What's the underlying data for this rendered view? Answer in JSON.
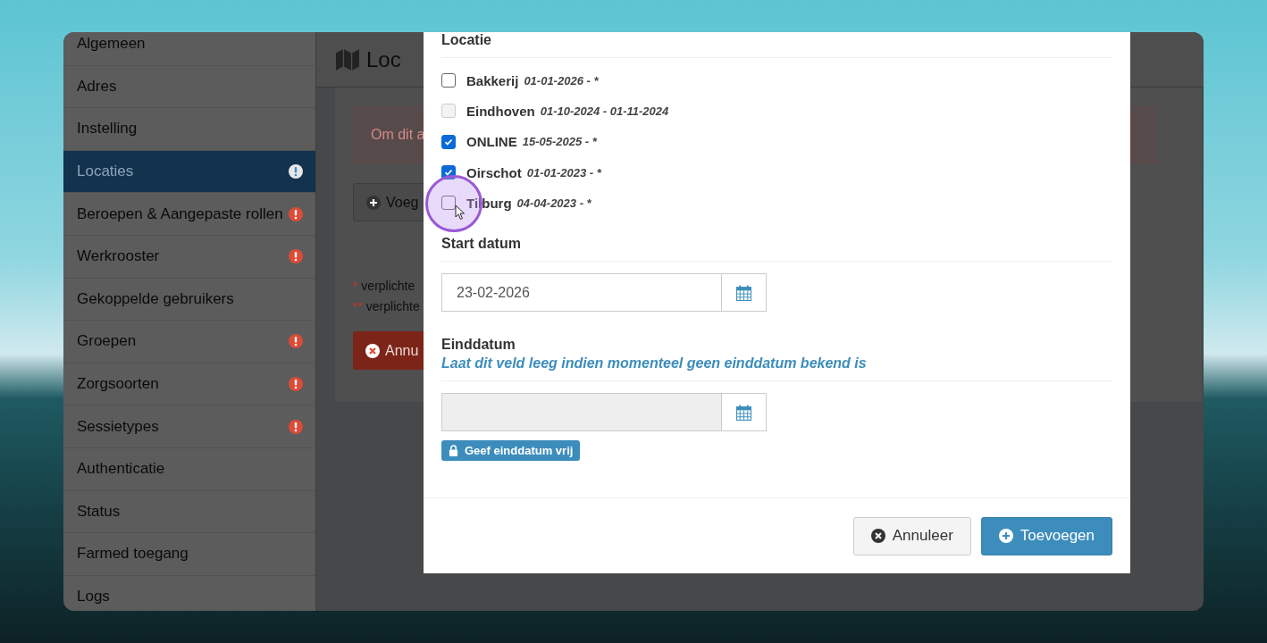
{
  "sidebar": {
    "items": [
      {
        "label": "Algemeen",
        "selected": false,
        "warning": false
      },
      {
        "label": "Adres",
        "selected": false,
        "warning": false
      },
      {
        "label": "Instelling",
        "selected": false,
        "warning": false
      },
      {
        "label": "Locaties",
        "selected": true,
        "warning": true
      },
      {
        "label": "Beroepen & Aangepaste rollen",
        "selected": false,
        "warning": true
      },
      {
        "label": "Werkrooster",
        "selected": false,
        "warning": true
      },
      {
        "label": "Gekoppelde gebruikers",
        "selected": false,
        "warning": false
      },
      {
        "label": "Groepen",
        "selected": false,
        "warning": true
      },
      {
        "label": "Zorgsoorten",
        "selected": false,
        "warning": true
      },
      {
        "label": "Sessietypes",
        "selected": false,
        "warning": true
      },
      {
        "label": "Authenticatie",
        "selected": false,
        "warning": false
      },
      {
        "label": "Status",
        "selected": false,
        "warning": false
      },
      {
        "label": "Farmed toegang",
        "selected": false,
        "warning": false
      },
      {
        "label": "Logs",
        "selected": false,
        "warning": false
      }
    ]
  },
  "main": {
    "page_title": "Loc",
    "alert": "Om dit a",
    "add_button": "Voeg",
    "notes": [
      {
        "marker": "*",
        "text": "verplichte"
      },
      {
        "marker": "**",
        "text": "verplichte"
      }
    ],
    "cancel_button": "Annu"
  },
  "modal": {
    "section_title": "Locatie",
    "locations": [
      {
        "name": "Bakkerij",
        "period": "01-01-2026 - *",
        "checked": false,
        "disabled": false
      },
      {
        "name": "Eindhoven",
        "period": "01-10-2024 - 01-11-2024",
        "checked": false,
        "disabled": true
      },
      {
        "name": "ONLINE",
        "period": "15-05-2025 - *",
        "checked": true,
        "disabled": false
      },
      {
        "name": "Oirschot",
        "period": "01-01-2023 - *",
        "checked": true,
        "disabled": false
      },
      {
        "name": "Tilburg",
        "period": "04-04-2023 - *",
        "checked": false,
        "disabled": false
      }
    ],
    "start_date": {
      "label": "Start datum",
      "value": "23-02-2026"
    },
    "end_date": {
      "label": "Einddatum",
      "help": "Laat dit veld leeg indien momenteel geen einddatum bekend is",
      "disabled": true,
      "unlock_button": "Geef einddatum vrij"
    },
    "buttons": [
      {
        "label": "Annuleer",
        "kind": "cancel"
      },
      {
        "label": "Toevoegen",
        "kind": "primary"
      }
    ]
  }
}
